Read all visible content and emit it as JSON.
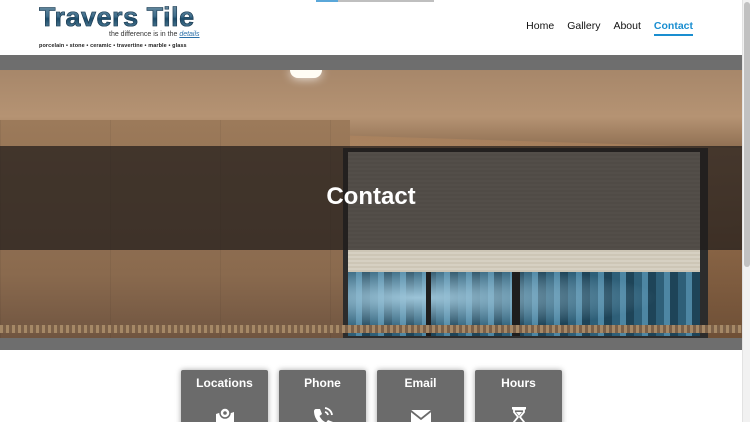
{
  "brand": {
    "title": "Travers Tile",
    "tagline_prefix": "the difference is in the",
    "tagline_accent": "details",
    "materials": "porcelain  •  stone  •  ceramic  •  travertine  •  marble  •  glass"
  },
  "nav": {
    "items": [
      {
        "label": "Home"
      },
      {
        "label": "Gallery"
      },
      {
        "label": "About"
      },
      {
        "label": "Contact",
        "active": true
      }
    ]
  },
  "hero": {
    "title": "Contact"
  },
  "cards": [
    {
      "title": "Locations",
      "icon": "map-pin-icon"
    },
    {
      "title": "Phone",
      "icon": "phone-icon"
    },
    {
      "title": "Email",
      "icon": "envelope-icon"
    },
    {
      "title": "Hours",
      "icon": "hourglass-icon"
    }
  ],
  "colors": {
    "accent": "#1a8ed0",
    "card_bg": "#6b6b6b",
    "band": "#6e6e6e"
  }
}
